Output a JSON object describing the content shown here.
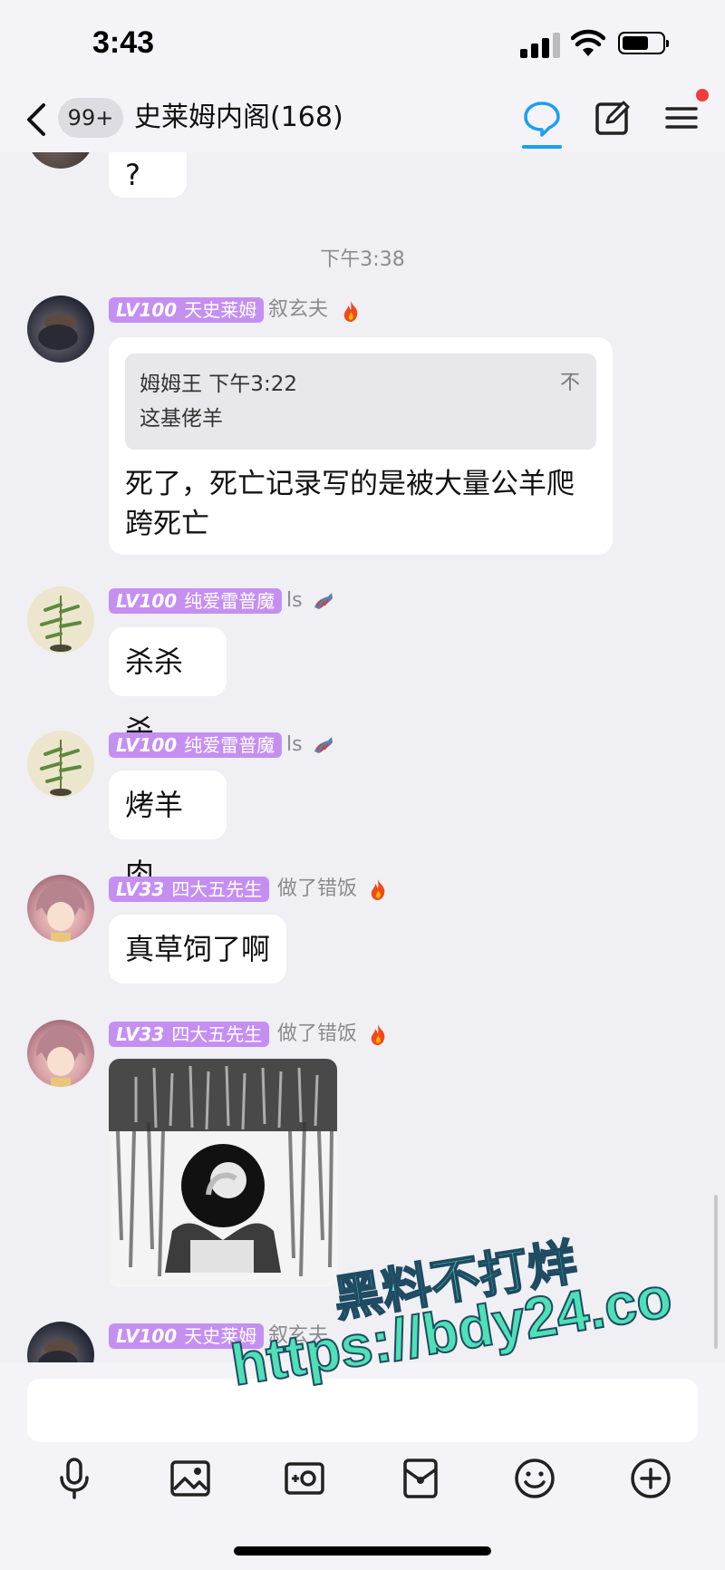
{
  "status_bar": {
    "time": "3:43"
  },
  "nav": {
    "unread_badge": "99+",
    "title": "史莱姆内阁(168)"
  },
  "messages": {
    "prev_bubble": "?",
    "time_divider": "下午3:38",
    "msg1": {
      "level": "LV100",
      "title": "天史莱姆",
      "sender": "叙玄夫",
      "quote_author_time": "姆姆王 下午3:22",
      "quote_text": "这基佬羊",
      "quote_pin": "不",
      "reply_line1": "死了，死亡记录写的是被大量公羊爬",
      "reply_line2": "跨死亡"
    },
    "msg2": {
      "level": "LV100",
      "title": "纯爱雷普魔",
      "sender": "ls",
      "text": "杀杀杀"
    },
    "msg3": {
      "level": "LV100",
      "title": "纯爱雷普魔",
      "sender": "ls",
      "text": "烤羊肉"
    },
    "msg4": {
      "level": "LV33",
      "title": "四大五先生",
      "sender": "做了错饭",
      "text": "真草饲了啊"
    },
    "msg5": {
      "level": "LV33",
      "title": "四大五先生",
      "sender": "做了错饭"
    },
    "msg6": {
      "level": "LV100",
      "title": "天史莱姆",
      "sender": "叙玄夫"
    }
  },
  "watermark": {
    "line1": "黑料不打烊",
    "line2": "https://bdy24.co"
  },
  "input": {
    "placeholder": ""
  },
  "colors": {
    "accent": "#1c9ef5",
    "level_badge": "#c58ff2",
    "notification_dot": "#f23c3c",
    "watermark": "#4ee0b6"
  }
}
